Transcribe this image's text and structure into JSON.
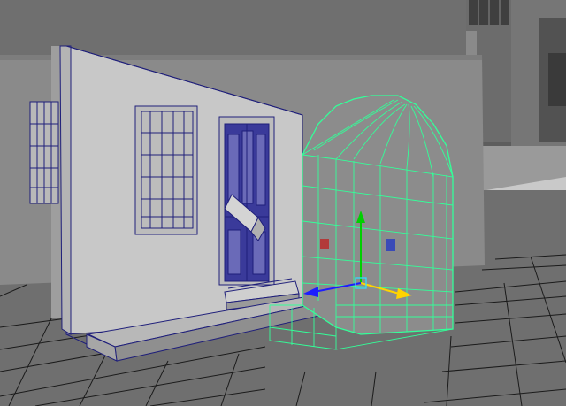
{
  "viewport": {
    "view": "perspective",
    "mode": "wireframe-on-shaded",
    "colors": {
      "background": "#6d6d6d",
      "grid_line": "#1b1b1b",
      "wireframe": "#1f1f7a",
      "selection": "#33ff99",
      "wall": "#c8c8c8",
      "move_x": "#ffd400",
      "move_y": "#00d000",
      "move_z": "#1d1dff"
    }
  },
  "scene": {
    "objects": [
      "house-front-wall",
      "left-window",
      "center-window",
      "front-door",
      "door-sign",
      "door-step",
      "foundation-slab",
      "arched-doorway",
      "background-photo"
    ],
    "selected": "arched-doorway",
    "manipulator": "move-tool"
  }
}
